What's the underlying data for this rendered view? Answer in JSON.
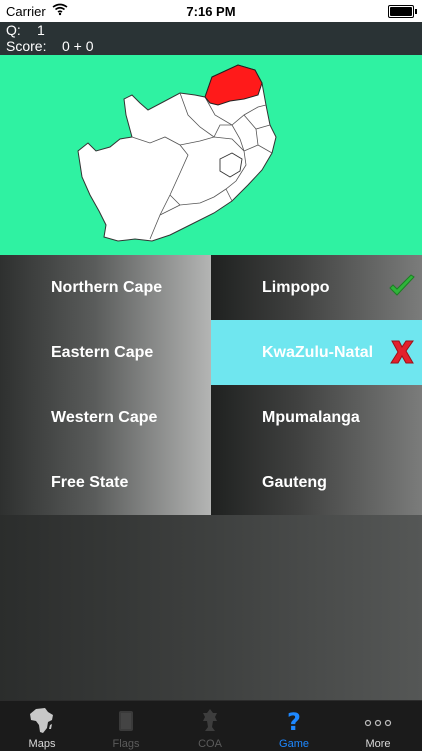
{
  "status_bar": {
    "carrier": "Carrier",
    "time": "7:16 PM"
  },
  "score_panel": {
    "q_label": "Q:",
    "q_value": "1",
    "score_label": "Score:",
    "score_value": "0 + 0"
  },
  "map": {
    "highlight_color": "#ff1a1a",
    "background_color": "#2ff2a2",
    "highlighted_region": "Limpopo"
  },
  "answers": {
    "left": [
      {
        "label": "Northern Cape"
      },
      {
        "label": "Eastern Cape"
      },
      {
        "label": "Western Cape"
      },
      {
        "label": "Free State"
      }
    ],
    "right": [
      {
        "label": "Limpopo",
        "state": "correct",
        "icon": "check-icon"
      },
      {
        "label": "KwaZulu-Natal",
        "state": "wrong",
        "icon": "cross-icon"
      },
      {
        "label": "Mpumalanga",
        "state": "none"
      },
      {
        "label": "Gauteng",
        "state": "none"
      }
    ]
  },
  "tabs": [
    {
      "label": "Maps",
      "icon": "africa-map-icon",
      "state": "normal"
    },
    {
      "label": "Flags",
      "icon": "flag-icon",
      "state": "disabled"
    },
    {
      "label": "COA",
      "icon": "coat-of-arms-icon",
      "state": "disabled"
    },
    {
      "label": "Game",
      "icon": "question-mark-icon",
      "state": "active"
    },
    {
      "label": "More",
      "icon": "more-dots-icon",
      "state": "normal"
    }
  ]
}
